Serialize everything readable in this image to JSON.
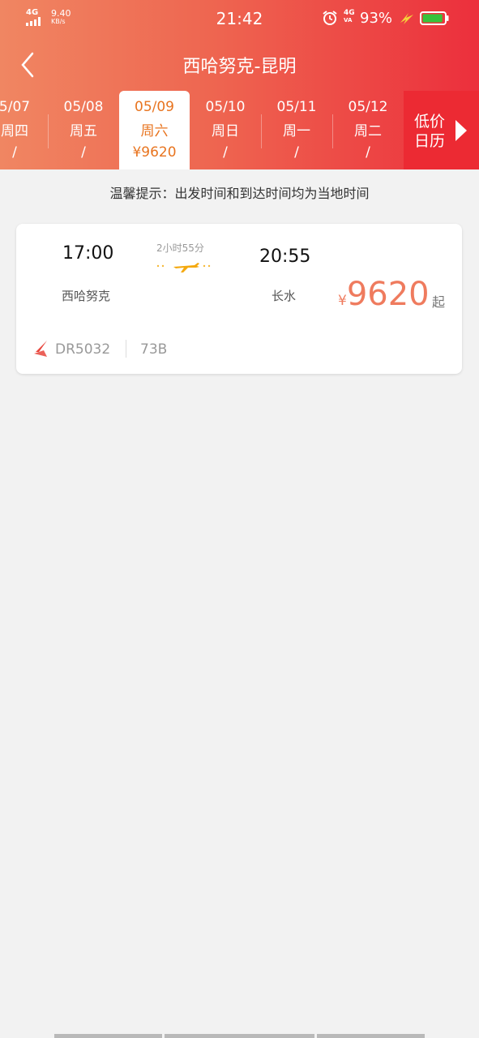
{
  "status_bar": {
    "signal_label": "4G",
    "net_speed": "9.40",
    "net_speed_unit": "KB/s",
    "time": "21:42",
    "signal2_top": "4G",
    "signal2_bottom": "VA",
    "battery_percent": "93%",
    "battery_level": 0.93,
    "icons": [
      "signal-icon",
      "alarm-icon",
      "charging-icon",
      "battery-icon"
    ]
  },
  "nav": {
    "title": "西哈努克-昆明",
    "back_icon": "chevron-left-icon"
  },
  "date_tabs": [
    {
      "date": "5/07",
      "weekday": "周四",
      "price": "/"
    },
    {
      "date": "05/08",
      "weekday": "周五",
      "price": "/"
    },
    {
      "date": "05/09",
      "weekday": "周六",
      "price": "¥9620",
      "active": true
    },
    {
      "date": "05/10",
      "weekday": "周日",
      "price": "/"
    },
    {
      "date": "05/11",
      "weekday": "周一",
      "price": "/"
    },
    {
      "date": "05/12",
      "weekday": "周二",
      "price": "/"
    }
  ],
  "calendar_button": {
    "line1": "低价",
    "line2": "日历",
    "icon": "triangle-right-icon"
  },
  "notice": "温馨提示：出发时间和到达时间均为当地时间",
  "flight": {
    "dep_time": "17:00",
    "arr_time": "20:55",
    "duration": "2小时55分",
    "dep_city": "西哈努克",
    "arr_city": "长水",
    "currency": "¥",
    "price": "9620",
    "price_suffix": "起",
    "flight_no": "DR5032",
    "aircraft": "73B",
    "airline_icon": "airline-logo-icon",
    "plane_icon": "airplane-icon"
  },
  "colors": {
    "header_start": "#f08662",
    "header_end": "#ec2f3c",
    "accent_orange": "#e8741f",
    "price_color": "#ef7b5e",
    "calendar_bg": "#ec2a33"
  }
}
